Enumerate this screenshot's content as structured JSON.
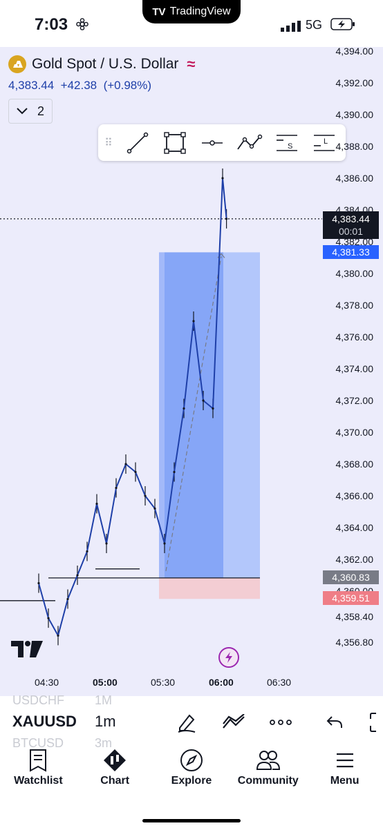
{
  "status": {
    "time": "7:03",
    "island": "TradingView",
    "network": "5G"
  },
  "symbol": {
    "title": "Gold Spot / U.S. Dollar",
    "last": "4,383.44",
    "change": "+42.38",
    "change_pct": "(+0.98%)",
    "layer_count": "2"
  },
  "price_axis": [
    "4,394.00",
    "4,392.00",
    "4,390.00",
    "4,388.00",
    "4,386.00",
    "4,384.00",
    "4,382.00",
    "4,380.00",
    "4,378.00",
    "4,376.00",
    "4,374.00",
    "4,372.00",
    "4,370.00",
    "4,368.00",
    "4,366.00",
    "4,364.00",
    "4,362.00",
    "4,360.00",
    "4,358.40",
    "4,356.80"
  ],
  "tags": {
    "last_price": "4,383.44",
    "countdown": "00:01",
    "target": "4,381.33",
    "entry": "4,360.83",
    "stop": "4,359.51"
  },
  "time_axis": [
    "04:30",
    "05:00",
    "05:30",
    "06:00",
    "06:30"
  ],
  "time_axis_bold": [
    false,
    true,
    false,
    true,
    false
  ],
  "bottom": {
    "ticker_prev": "USDCHF",
    "interval_prev": "1M",
    "ticker": "XAUUSD",
    "interval": "1m",
    "ticker_next": "BTCUSD",
    "interval_next": "3m"
  },
  "nav": [
    {
      "label": "Watchlist",
      "icon": "watchlist-icon"
    },
    {
      "label": "Chart",
      "icon": "chart-icon"
    },
    {
      "label": "Explore",
      "icon": "compass-icon"
    },
    {
      "label": "Community",
      "icon": "community-icon"
    },
    {
      "label": "Menu",
      "icon": "menu-icon"
    }
  ],
  "colors": {
    "accent": "#2962ff",
    "target_fill": "#7ea3f5",
    "stop_fill": "#f3cdd3",
    "candle": "#1e3fa8",
    "badge_purple": "#9c27b0"
  },
  "chart_data": {
    "type": "line",
    "x": [
      "04:25",
      "04:30",
      "04:35",
      "04:40",
      "04:45",
      "04:50",
      "04:55",
      "05:00",
      "05:05",
      "05:10",
      "05:15",
      "05:20",
      "05:25",
      "05:30",
      "05:35",
      "05:40",
      "05:45",
      "05:50",
      "05:55",
      "06:00",
      "06:02"
    ],
    "series": [
      {
        "values": [
          4360.5,
          4358.3,
          4357.2,
          4359.5,
          4361.0,
          4362.5,
          4365.5,
          4363.0,
          4366.5,
          4368.0,
          4367.5,
          4366.0,
          4365.2,
          4363.0,
          4367.5,
          4371.5,
          4377.0,
          4372.0,
          4371.5,
          4386.0,
          4383.44
        ]
      }
    ],
    "ylim": [
      4355.8,
      4395.0
    ],
    "long_position": {
      "entry": 4360.83,
      "target": 4381.33,
      "stop": 4359.51
    }
  }
}
